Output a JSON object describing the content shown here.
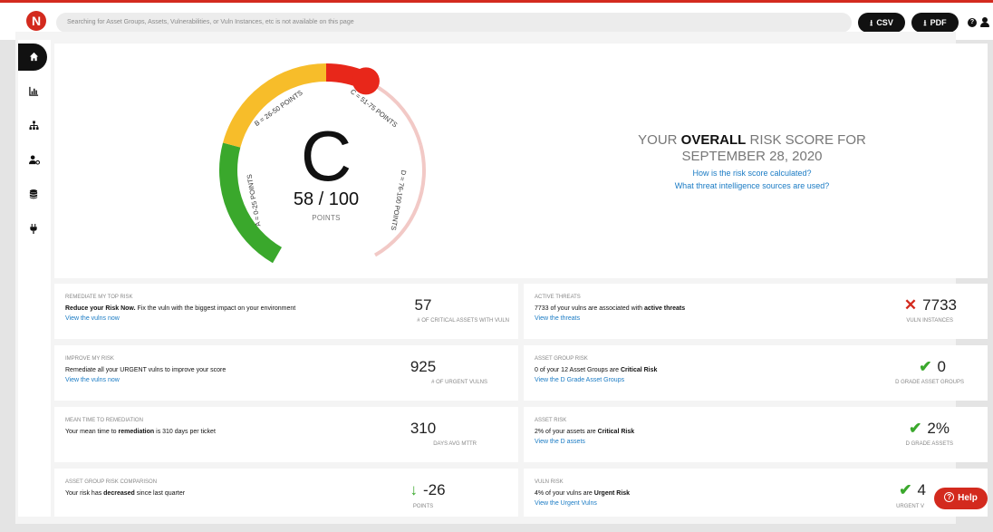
{
  "app": {
    "logo_letter": "N",
    "accent": "#d32a1e"
  },
  "topbar": {
    "search_placeholder": "Searching for Asset Groups, Assets, Vulnerabilities, or Vuln Instances, etc is not available on this page",
    "csv_label": "CSV",
    "pdf_label": "PDF",
    "help_icon": "?"
  },
  "sidebar": {
    "items": [
      {
        "name": "home-icon",
        "active": true
      },
      {
        "name": "chart-icon",
        "active": false
      },
      {
        "name": "hierarchy-icon",
        "active": false
      },
      {
        "name": "user-settings-icon",
        "active": false
      },
      {
        "name": "database-icon",
        "active": false
      },
      {
        "name": "plug-icon",
        "active": false
      }
    ]
  },
  "gauge": {
    "grade": "C",
    "score": "58 / 100",
    "points_label": "POINTS",
    "score_value": 58,
    "score_max": 100,
    "segments": [
      {
        "label": "A = 0-25 POINTS",
        "color": "#3aa82c"
      },
      {
        "label": "B = 26-50 POINTS",
        "color": "#f7bd2a"
      },
      {
        "label": "C = 51-75 POINTS",
        "color": "#e8271a"
      },
      {
        "label": "D = 76-100 POINTS",
        "color": "#f2c9c6"
      }
    ]
  },
  "headline": {
    "prefix": "YOUR ",
    "emphasis": "OVERALL",
    "suffix": " RISK SCORE FOR",
    "date": "SEPTEMBER 28, 2020",
    "link1": "How is the risk score calculated?",
    "link2": "What threat intelligence sources are used?"
  },
  "cards_left": [
    {
      "title": "REMEDIATE MY TOP RISK",
      "desc_b1": "Reduce your Risk Now.",
      "desc_rest": " Fix the vuln with the biggest impact on your environment",
      "link": "View the vulns now",
      "value": "57",
      "unit": "# OF CRITICAL ASSETS WITH VULN"
    },
    {
      "title": "IMPROVE MY RISK",
      "desc_pre": "Remediate all your URGENT vulns to improve your score",
      "link": "View the vulns now",
      "value": "925",
      "unit": "# OF URGENT VULNS"
    },
    {
      "title": "MEAN TIME TO REMEDIATION",
      "desc_pre": "Your mean time to ",
      "desc_b": "remediation",
      "desc_post": " is 310 days per ticket",
      "value": "310",
      "unit": "DAYS AVG MTTR"
    },
    {
      "title": "ASSET GROUP RISK COMPARISON",
      "desc_pre": "Your risk has ",
      "desc_b": "decreased",
      "desc_post": " since last quarter",
      "value": "-26",
      "unit": "POINTS"
    }
  ],
  "cards_right": [
    {
      "title": "ACTIVE THREATS",
      "desc_pre": "7733 of your vulns are associated with ",
      "desc_b": "active threats",
      "link": "View the threats",
      "value": "7733",
      "unit": "VULN INSTANCES"
    },
    {
      "title": "ASSET GROUP RISK",
      "desc_pre": "0 of your 12 Asset Groups are ",
      "desc_b": "Critical Risk",
      "link": "View the D Grade Asset Groups",
      "value": "0",
      "unit": "D GRADE ASSET GROUPS"
    },
    {
      "title": "ASSET RISK",
      "desc_pre": "2% of your assets are ",
      "desc_b": "Critical Risk",
      "link": "View the D assets",
      "value": "2%",
      "unit": "D GRADE ASSETS"
    },
    {
      "title": "VULN RISK",
      "desc_pre": "4% of your vulns are ",
      "desc_b": "Urgent Risk",
      "link": "View the Urgent Vulns",
      "value": "4",
      "unit": "URGENT V"
    }
  ],
  "help": {
    "label": "Help"
  }
}
